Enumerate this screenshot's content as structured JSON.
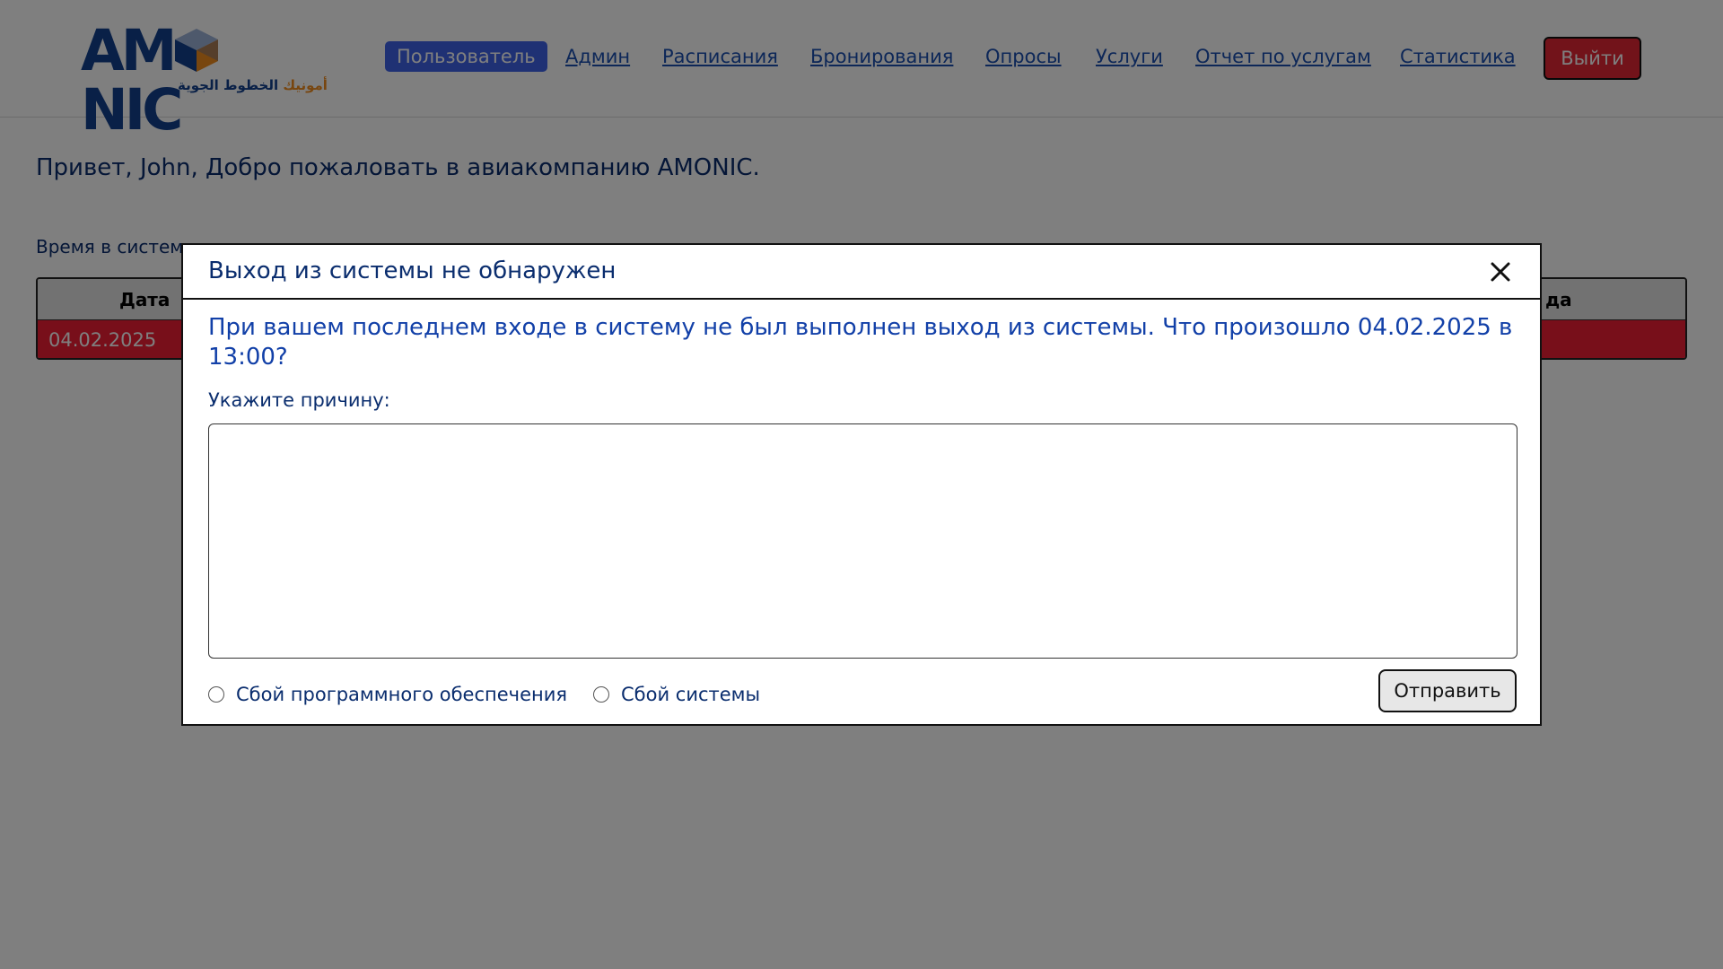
{
  "header": {
    "logo_text": "AMONIC",
    "logo_arabic_dark": "الخطوط الجوية",
    "logo_arabic_orange": "أمونيك",
    "nav": [
      {
        "label": "Пользователь",
        "active": true
      },
      {
        "label": "Админ"
      },
      {
        "label": "Расписания"
      },
      {
        "label": "Бронирования"
      },
      {
        "label": "Опросы"
      },
      {
        "label": "Услуги"
      },
      {
        "label": "Отчет по услугам"
      },
      {
        "label": "Статистика"
      }
    ],
    "logout_label": "Выйти"
  },
  "main": {
    "greeting": "Привет, John, Добро пожаловать в авиакомпанию AMONIC.",
    "stats_partial": "Время в систем",
    "table": {
      "headers": [
        "Дата",
        "да"
      ],
      "row": [
        "04.02.2025"
      ]
    }
  },
  "modal": {
    "title": "Выход из системы не обнаружен",
    "message": "При вашем последнем входе в систему не был выполнен выход из системы. Что произошло 04.02.2025 в 13:00?",
    "reason_label": "Укажите причину:",
    "reason_value": "",
    "options": [
      "Сбой программного обеспечения",
      "Сбой системы"
    ],
    "submit_label": "Отправить"
  },
  "colors": {
    "brand_blue": "#13418f",
    "nav_active_bg": "#3f62e8",
    "logout_bg": "#e52735",
    "row_red": "#f01e35",
    "overlay": "rgba(0,0,0,0.5)"
  }
}
